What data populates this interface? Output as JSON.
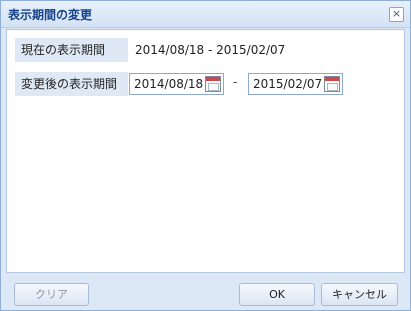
{
  "dialog": {
    "title": "表示期間の変更",
    "close_icon": "close-icon"
  },
  "current_period": {
    "label": "現在の表示期間",
    "value": "2014/08/18 - 2015/02/07"
  },
  "new_period": {
    "label": "変更後の表示期間",
    "start": "2014/08/18",
    "separator": "-",
    "end": "2015/02/07",
    "calendar_icon": "calendar-icon"
  },
  "buttons": {
    "clear": "クリア",
    "ok": "OK",
    "cancel": "キャンセル"
  },
  "colors": {
    "title_text": "#15428b",
    "frame": "#dce8f6",
    "label_bg": "#dfe9f6"
  }
}
